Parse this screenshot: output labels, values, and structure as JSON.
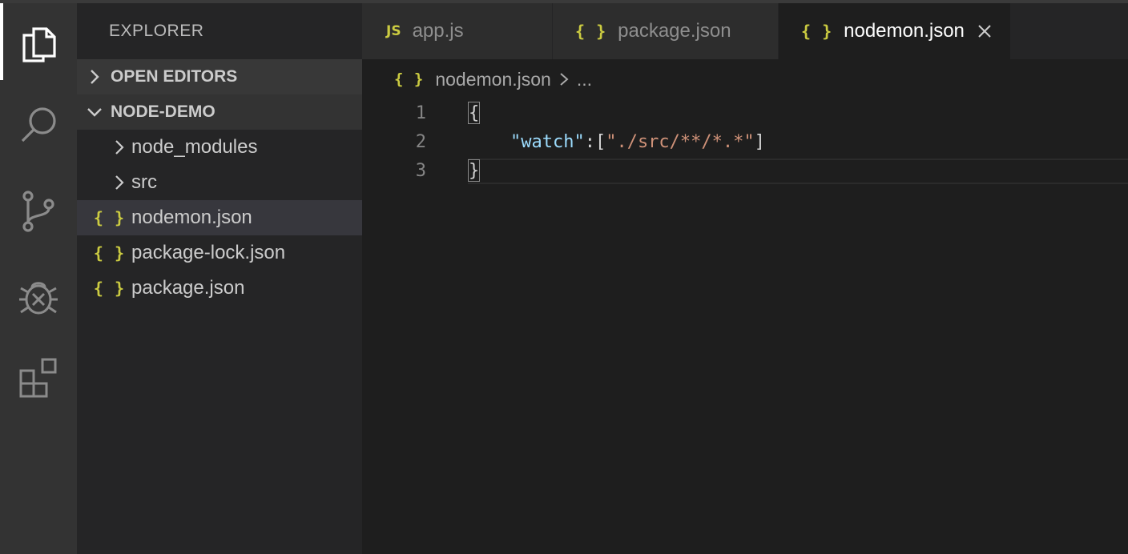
{
  "sidebar": {
    "title": "EXPLORER",
    "open_editors_label": "OPEN EDITORS",
    "project_label": "NODE-DEMO",
    "items": [
      {
        "label": "node_modules",
        "type": "folder"
      },
      {
        "label": "src",
        "type": "folder"
      },
      {
        "label": "nodemon.json",
        "type": "json",
        "selected": true
      },
      {
        "label": "package-lock.json",
        "type": "json"
      },
      {
        "label": "package.json",
        "type": "json"
      }
    ]
  },
  "tabs": [
    {
      "label": "app.js",
      "icon": "JS"
    },
    {
      "label": "package.json",
      "icon": "{ }"
    },
    {
      "label": "nodemon.json",
      "icon": "{ }",
      "active": true
    }
  ],
  "breadcrumb": {
    "icon": "{ }",
    "file": "nodemon.json",
    "more": "..."
  },
  "editor": {
    "line_numbers": [
      "1",
      "2",
      "3"
    ],
    "open_brace": "{",
    "key": "\"watch\"",
    "colon_bracket": ":[",
    "value": "\"./src/**/*.*\"",
    "close_bracket": "]",
    "close_brace": "}"
  },
  "icons": {
    "json_glyph": "{ }"
  },
  "colors": {
    "json_icon": "#cbcb41",
    "js_icon": "#cbcb41",
    "json_key": "#9cdcfe",
    "json_string": "#ce9178"
  }
}
